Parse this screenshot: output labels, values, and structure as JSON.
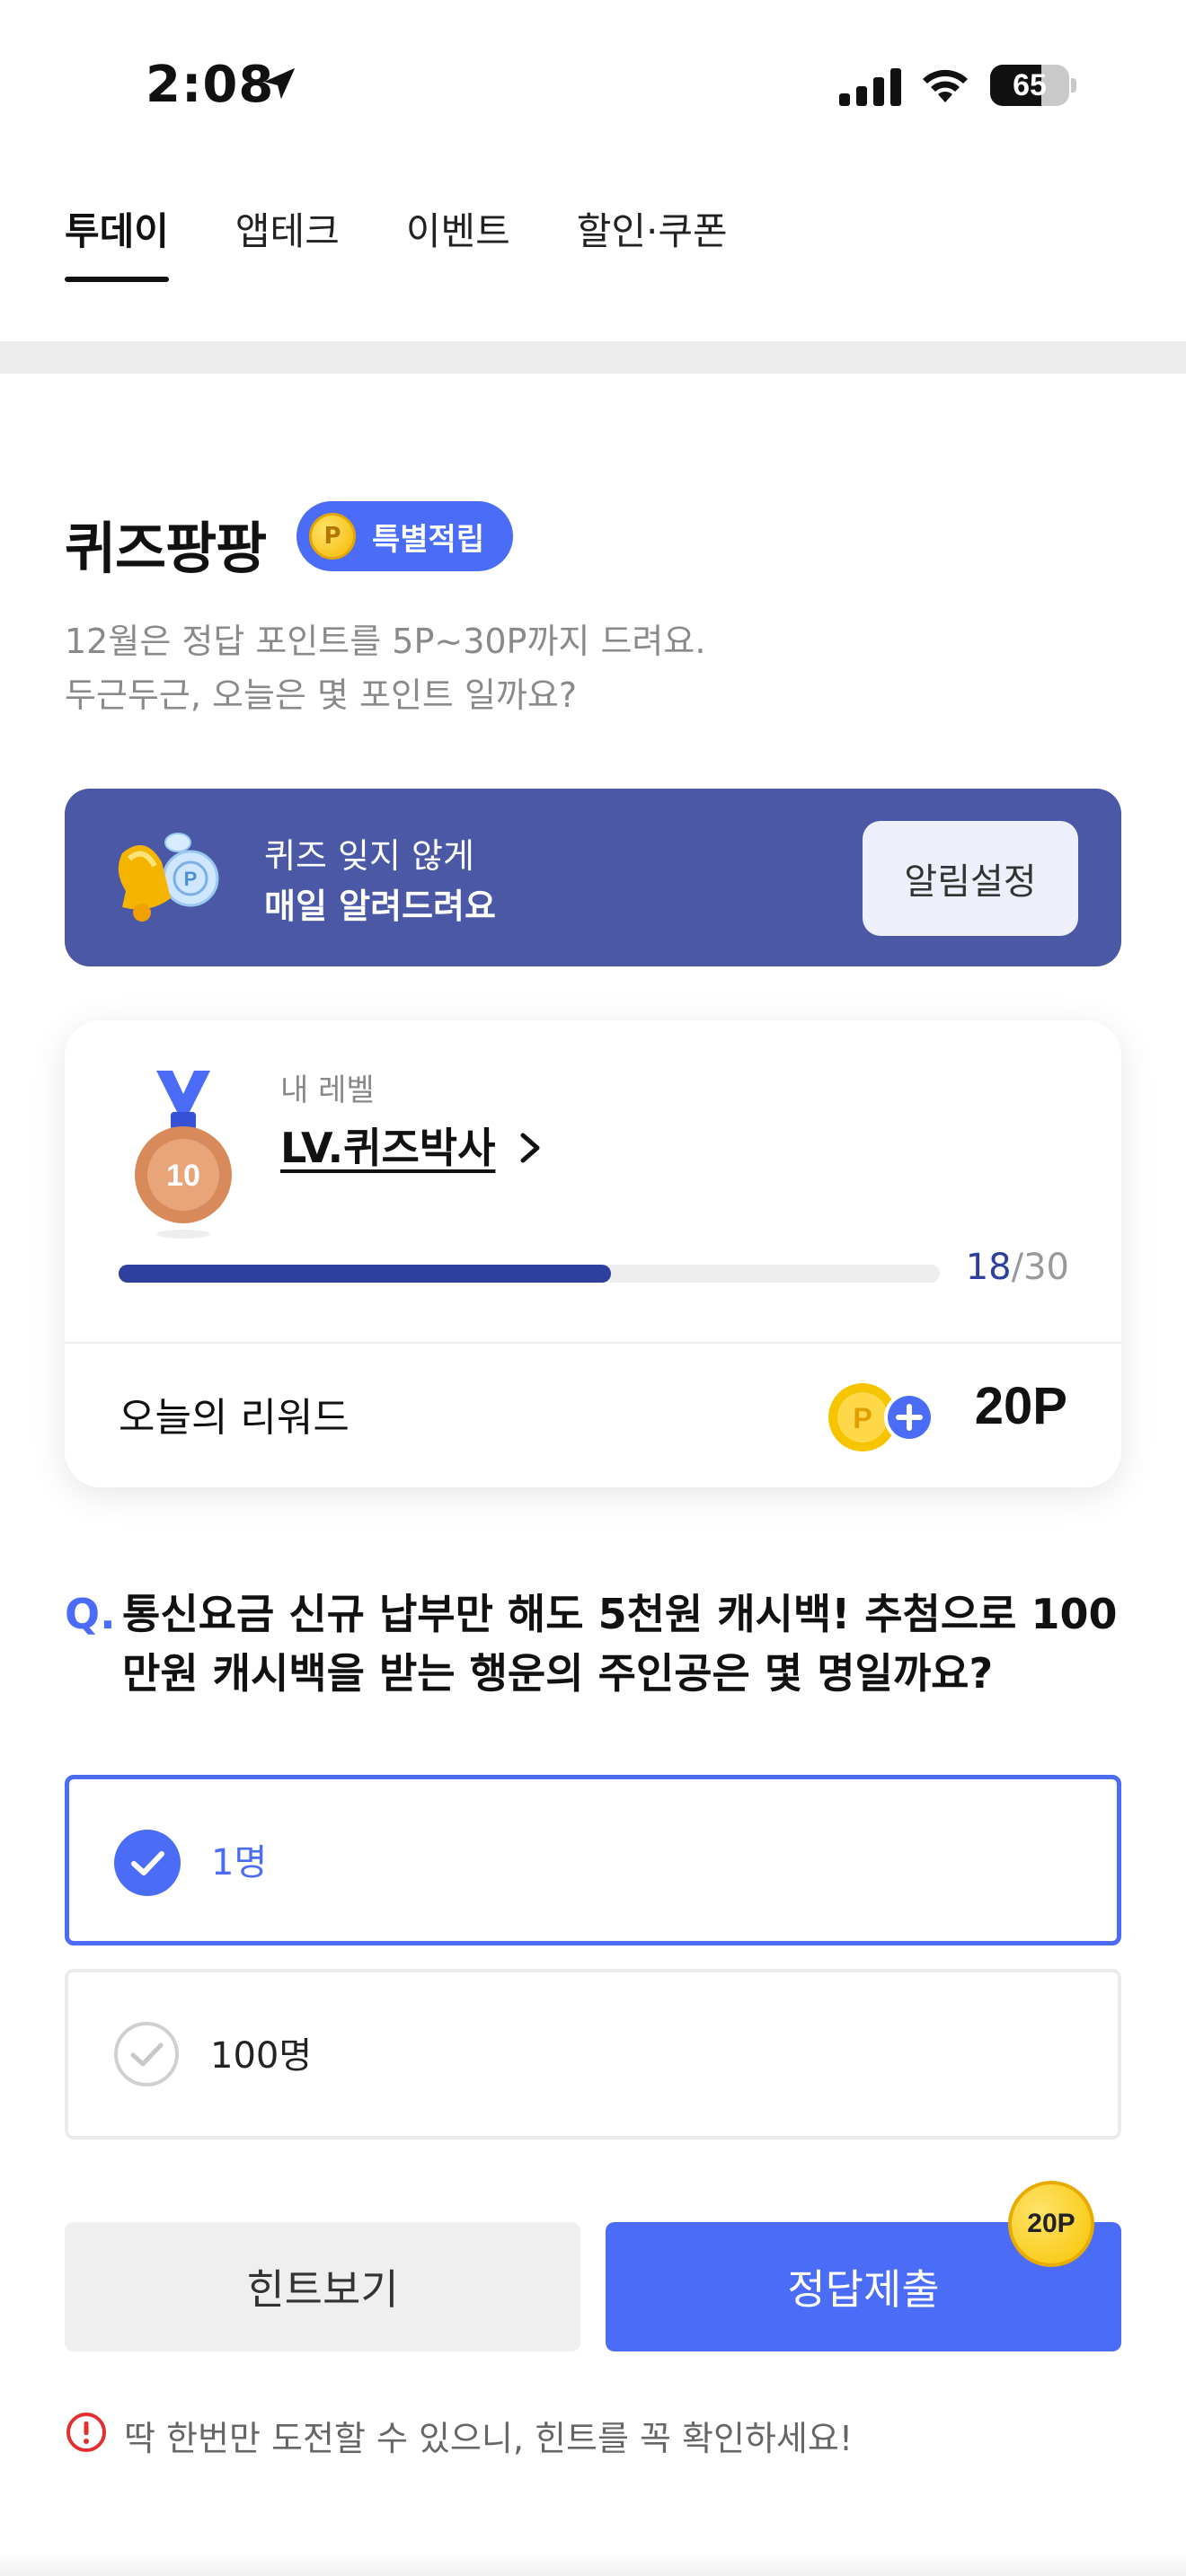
{
  "status_bar": {
    "time": "2:08",
    "battery": "65",
    "battery_level": 0.65
  },
  "tabs": [
    {
      "label": "투데이",
      "active": true
    },
    {
      "label": "앱테크",
      "active": false
    },
    {
      "label": "이벤트",
      "active": false
    },
    {
      "label": "할인·쿠폰",
      "active": false
    }
  ],
  "quiz": {
    "title": "퀴즈팡팡",
    "badge_coin": "P",
    "badge": "특별적립",
    "desc_line1": "12월은 정답 포인트를 5P~30P까지 드려요.",
    "desc_line2": "두근두근, 오늘은 몇 포인트 일까요?"
  },
  "banner": {
    "line1": "퀴즈 잊지 않게",
    "line2": "매일 알려드려요",
    "button": "알림설정"
  },
  "level": {
    "caption": "내 레벨",
    "medal_number": "10",
    "name": "LV.퀴즈박사",
    "progress_current": "18",
    "progress_total": "/30",
    "progress_fraction": 0.6,
    "reward_label": "오늘의 리워드",
    "reward_value": "20P"
  },
  "question": {
    "marker": "Q.",
    "text": "통신요금 신규 납부만 해도 5천원 캐시백! 추첨으로 100만원 캐시백을 받는 행운의 주인공은 몇 명일까요?",
    "options": [
      {
        "label": "1명",
        "selected": true
      },
      {
        "label": "100명",
        "selected": false
      }
    ]
  },
  "actions": {
    "hint": "힌트보기",
    "submit": "정답제출",
    "submit_badge": "20P"
  },
  "warning": "딱 한번만 도전할 수 있으니, 힌트를 꼭 확인하세요!",
  "colors": {
    "accent": "#4a6cf7",
    "banner_bg": "#4a58a6",
    "progress": "#2e3f9e"
  }
}
